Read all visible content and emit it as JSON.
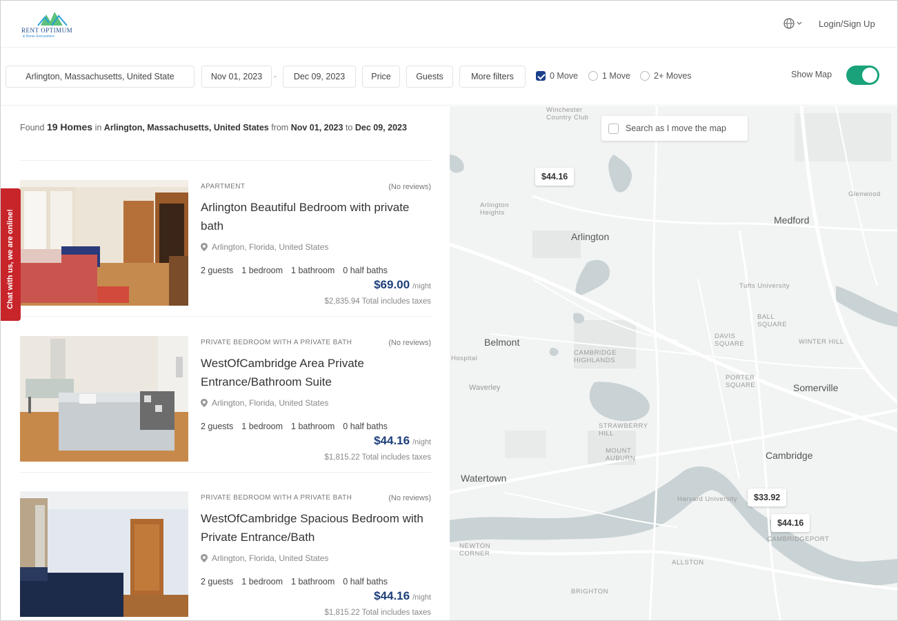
{
  "header": {
    "logo_name": "RENT OPTIMUM",
    "logo_tagline": "& Rome Everywhere",
    "globe_icon": "globe-icon",
    "login_label": "Login/Sign Up"
  },
  "filters": {
    "location": "Arlington, Massachusetts, United State",
    "date_from": "Nov 01, 2023",
    "date_separator": "-",
    "date_to": "Dec 09, 2023",
    "price_label": "Price",
    "guests_label": "Guests",
    "more_filters_label": "More filters",
    "moves": [
      {
        "label": "0 Move",
        "checked": true
      },
      {
        "label": "1 Move",
        "checked": false
      },
      {
        "label": "2+ Moves",
        "checked": false
      }
    ],
    "show_map_label": "Show Map",
    "show_map_on": true
  },
  "results": {
    "found_prefix": "Found",
    "count": "19 Homes",
    "in_word": "in",
    "location": "Arlington, Massachusetts, United States",
    "from_word": "from",
    "date_from": "Nov 01, 2023",
    "to_word": "to",
    "date_to": "Dec 09, 2023",
    "listings": [
      {
        "type": "APARTMENT",
        "reviews": "(No reviews)",
        "title": "Arlington Beautiful Bedroom with private bath",
        "location": "Arlington, Florida, United States",
        "guests": "2 guests",
        "bedrooms": "1 bedroom",
        "bathrooms": "1 bathroom",
        "half_baths": "0 half baths",
        "price": "$69.00",
        "per": "/night",
        "total": "$2,835.94 Total includes taxes"
      },
      {
        "type": "PRIVATE BEDROOM WITH A PRIVATE BATH",
        "reviews": "(No reviews)",
        "title": "WestOfCambridge Area Private Entrance/Bathroom Suite",
        "location": "Arlington, Florida, United States",
        "guests": "2 guests",
        "bedrooms": "1 bedroom",
        "bathrooms": "1 bathroom",
        "half_baths": "0 half baths",
        "price": "$44.16",
        "per": "/night",
        "total": "$1,815.22 Total includes taxes"
      },
      {
        "type": "PRIVATE BEDROOM WITH A PRIVATE BATH",
        "reviews": "(No reviews)",
        "title": "WestOfCambridge Spacious Bedroom with Private Entrance/Bath",
        "location": "Arlington, Florida, United States",
        "guests": "2 guests",
        "bedrooms": "1 bedroom",
        "bathrooms": "1 bathroom",
        "half_baths": "0 half baths",
        "price": "$44.16",
        "per": "/night",
        "total": "$1,815.22 Total includes taxes"
      }
    ]
  },
  "chat_label": "Chat with us, we are online!",
  "map": {
    "search_as_move": "Search as I move the map",
    "markers": [
      "$44.16",
      "$33.92",
      "$44.16"
    ],
    "cities": {
      "arlington": "Arlington",
      "medford": "Medford",
      "belmont": "Belmont",
      "somerville": "Somerville",
      "cambridge": "Cambridge",
      "watertown": "Watertown",
      "waverley": "Waverley"
    },
    "neighborhoods": {
      "winchester": "Winchester Country Club",
      "arlington_heights": "Arlington Heights",
      "tufts": "Tufts University",
      "ball_square": "BALL SQUARE",
      "davis_square": "DAVIS SQUARE",
      "winter_hill": "WINTER HILL",
      "cambridge_highlands": "CAMBRIDGE HIGHLANDS",
      "porter_square": "PORTER SQUARE",
      "strawberry_hill": "STRAWBERRY HILL",
      "mount_auburn": "MOUNT AUBURN",
      "harvard": "Harvard University",
      "cambridgeport": "CAMBRIDGEPORT",
      "allston": "ALLSTON",
      "newton_corner": "NEWTON CORNER",
      "brighton": "BRIGHTON",
      "glenwood": "Glenwood",
      "hospital": "Hospital"
    }
  },
  "colors": {
    "accent_blue": "#1d3f7a",
    "toggle_green": "#1aa37a",
    "chat_red": "#c8252a",
    "water": "#c9d2d4"
  }
}
